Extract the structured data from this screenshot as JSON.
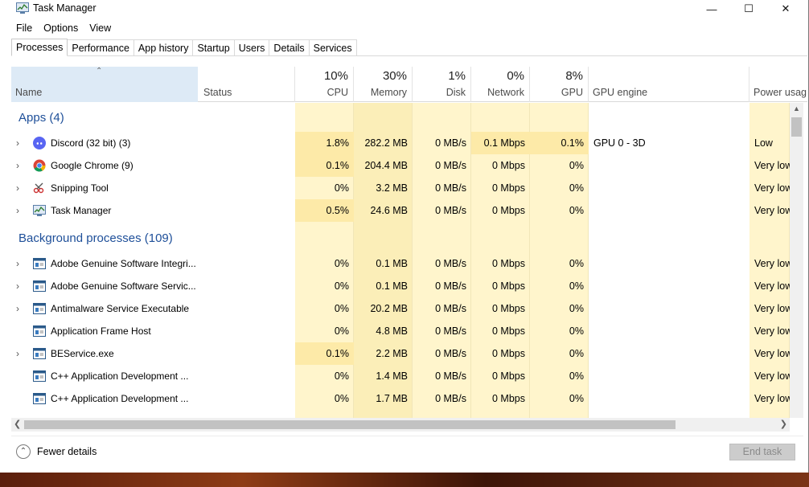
{
  "window": {
    "title": "Task Manager",
    "controls": {
      "minimize": "—",
      "maximize": "☐",
      "close": "✕"
    }
  },
  "menu": [
    "File",
    "Options",
    "View"
  ],
  "tabs": [
    "Processes",
    "Performance",
    "App history",
    "Startup",
    "Users",
    "Details",
    "Services"
  ],
  "header": {
    "name": "Name",
    "status": "Status",
    "cpu": {
      "pct": "10%",
      "label": "CPU"
    },
    "memory": {
      "pct": "30%",
      "label": "Memory"
    },
    "disk": {
      "pct": "1%",
      "label": "Disk"
    },
    "network": {
      "pct": "0%",
      "label": "Network"
    },
    "gpu": {
      "pct": "8%",
      "label": "GPU"
    },
    "gpu_engine": "GPU engine",
    "power": "Power usag"
  },
  "groups": {
    "apps": "Apps (4)",
    "background": "Background processes (109)"
  },
  "apps": [
    {
      "name": "Discord (32 bit) (3)",
      "icon": "discord-icon",
      "expand": true,
      "cpu": "1.8%",
      "memory": "282.2 MB",
      "disk": "0 MB/s",
      "network": "0.1 Mbps",
      "gpu": "0.1%",
      "gpu_engine": "GPU 0 - 3D",
      "power": "Low"
    },
    {
      "name": "Google Chrome (9)",
      "icon": "chrome-icon",
      "expand": true,
      "cpu": "0.1%",
      "memory": "204.4 MB",
      "disk": "0 MB/s",
      "network": "0 Mbps",
      "gpu": "0%",
      "gpu_engine": "",
      "power": "Very low"
    },
    {
      "name": "Snipping Tool",
      "icon": "snipping-tool-icon",
      "expand": true,
      "cpu": "0%",
      "memory": "3.2 MB",
      "disk": "0 MB/s",
      "network": "0 Mbps",
      "gpu": "0%",
      "gpu_engine": "",
      "power": "Very low"
    },
    {
      "name": "Task Manager",
      "icon": "task-manager-icon",
      "expand": true,
      "cpu": "0.5%",
      "memory": "24.6 MB",
      "disk": "0 MB/s",
      "network": "0 Mbps",
      "gpu": "0%",
      "gpu_engine": "",
      "power": "Very low"
    }
  ],
  "background": [
    {
      "name": "Adobe Genuine Software Integri...",
      "icon": "service-window-icon",
      "expand": true,
      "cpu": "0%",
      "memory": "0.1 MB",
      "disk": "0 MB/s",
      "network": "0 Mbps",
      "gpu": "0%",
      "power": "Very low"
    },
    {
      "name": "Adobe Genuine Software Servic...",
      "icon": "service-window-icon",
      "expand": true,
      "cpu": "0%",
      "memory": "0.1 MB",
      "disk": "0 MB/s",
      "network": "0 Mbps",
      "gpu": "0%",
      "power": "Very low"
    },
    {
      "name": "Antimalware Service Executable",
      "icon": "service-window-icon",
      "expand": true,
      "cpu": "0%",
      "memory": "20.2 MB",
      "disk": "0 MB/s",
      "network": "0 Mbps",
      "gpu": "0%",
      "power": "Very low"
    },
    {
      "name": "Application Frame Host",
      "icon": "service-window-icon",
      "expand": false,
      "cpu": "0%",
      "memory": "4.8 MB",
      "disk": "0 MB/s",
      "network": "0 Mbps",
      "gpu": "0%",
      "power": "Very low"
    },
    {
      "name": "BEService.exe",
      "icon": "service-window-icon",
      "expand": true,
      "cpu": "0.1%",
      "memory": "2.2 MB",
      "disk": "0 MB/s",
      "network": "0 Mbps",
      "gpu": "0%",
      "power": "Very low"
    },
    {
      "name": "C++ Application Development ...",
      "icon": "service-window-icon",
      "expand": false,
      "cpu": "0%",
      "memory": "1.4 MB",
      "disk": "0 MB/s",
      "network": "0 Mbps",
      "gpu": "0%",
      "power": "Very low"
    },
    {
      "name": "C++ Application Development ...",
      "icon": "service-window-icon",
      "expand": false,
      "cpu": "0%",
      "memory": "1.7 MB",
      "disk": "0 MB/s",
      "network": "0 Mbps",
      "gpu": "0%",
      "power": "Very low"
    }
  ],
  "footer": {
    "fewer_details": "Fewer details",
    "end_task": "End task"
  },
  "colors": {
    "accent": "#1e4f99",
    "heat_light": "#fff5cc",
    "heat_mem": "#fbeeb8",
    "sort_header": "#ddeaf6"
  }
}
